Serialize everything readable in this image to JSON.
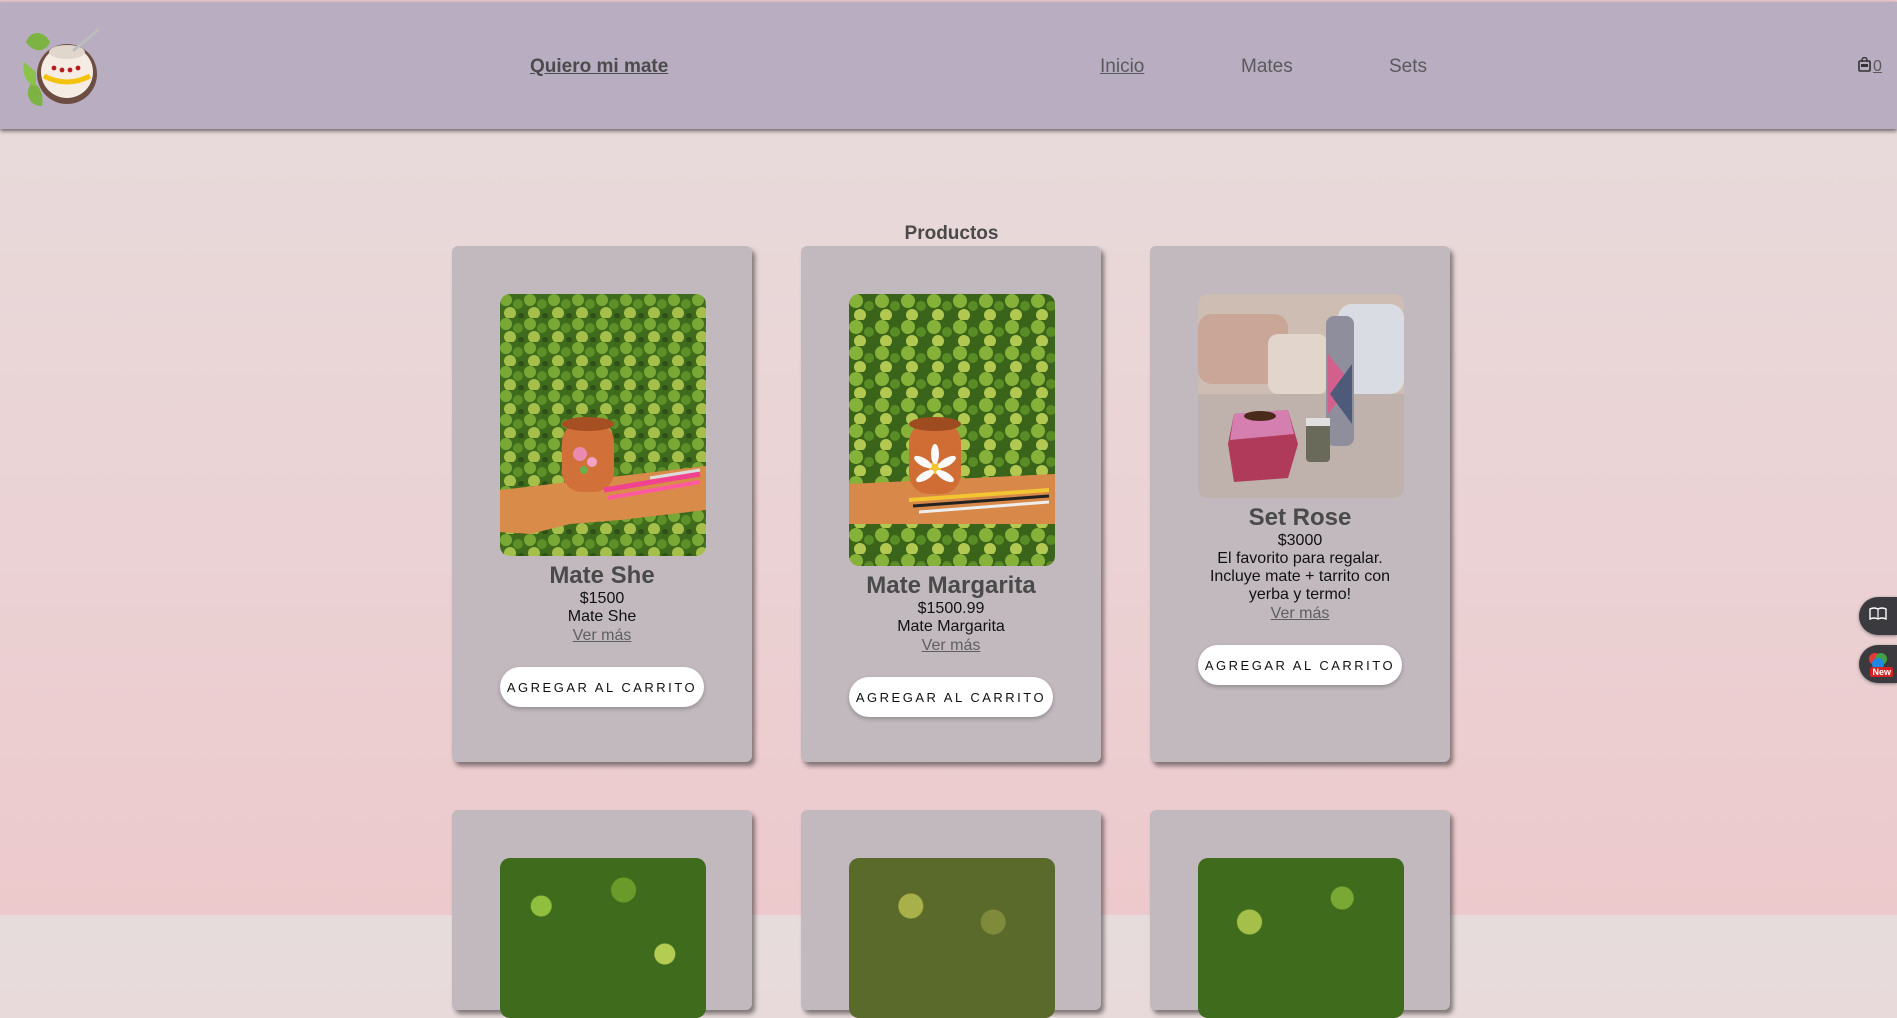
{
  "navbar": {
    "logo": "mate-logo",
    "brand": "Quiero mi mate",
    "links": [
      {
        "label": "Inicio",
        "active": true
      },
      {
        "label": "Mates",
        "active": false
      },
      {
        "label": "Sets",
        "active": false
      }
    ],
    "cart": {
      "icon": "shopping-bag-icon",
      "count": "0"
    }
  },
  "main": {
    "section_title": "Productos",
    "products": [
      {
        "title": "Mate She",
        "price": "$1500",
        "description": "Mate She",
        "more": "Ver más",
        "button": "AGREGAR AL CARRITO",
        "image": "orange mate with pink flowers on wooden board in front of ivy"
      },
      {
        "title": "Mate Margarita",
        "price": "$1500.99",
        "description": "Mate Margarita",
        "more": "Ver más",
        "button": "AGREGAR AL CARRITO",
        "image": "orange mate with daisy on wooden board in front of ivy"
      },
      {
        "title": "Set Rose",
        "price": "$3000",
        "description": "El favorito para regalar. Incluye mate + tarrito con yerba y termo!",
        "more": "Ver más",
        "button": "AGREGAR AL CARRITO",
        "image": "pink geometric mate, jar and thermos with cushions"
      }
    ]
  },
  "floating": {
    "reader_icon": "book-icon",
    "extension_icon": "colorful-extension-icon",
    "badge": "New"
  },
  "colors": {
    "navbar": "#b9adc1",
    "card": "#c2b9bf",
    "title": "#4a4a4a"
  }
}
